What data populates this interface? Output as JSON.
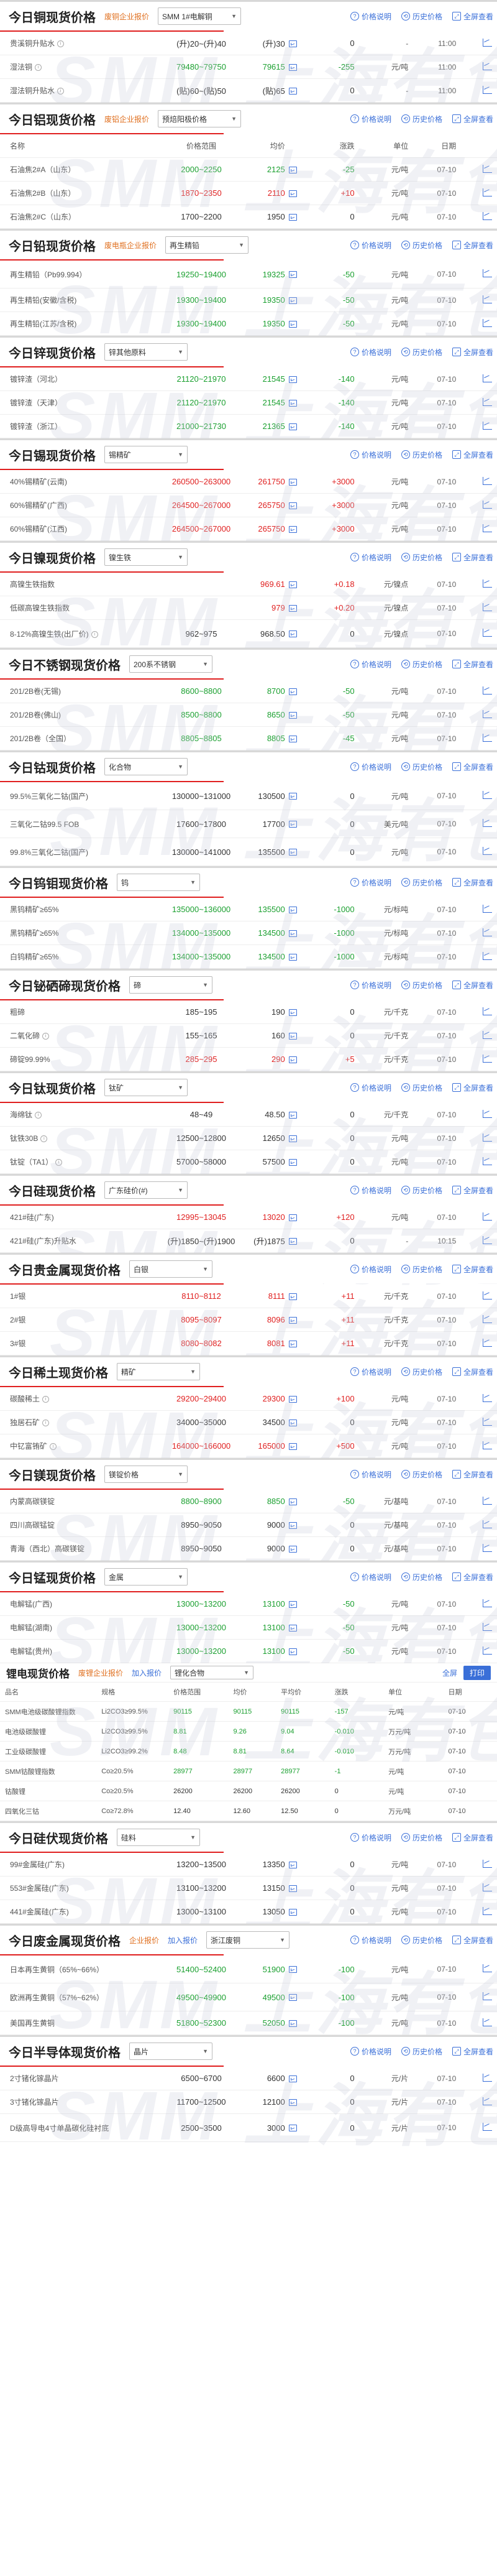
{
  "sections": [
    {
      "title": "今日铜现货价格",
      "sub": "废铜企业报价",
      "select": "SMM 1#电解铜",
      "actions": [
        "价格说明",
        "历史价格",
        "全屏查看"
      ],
      "rows": [
        {
          "name": "贵溪铜升贴水",
          "info": true,
          "range": "(升)20~(升)40",
          "avg": "(升)30",
          "chg": "0",
          "dir": "neutral",
          "unit": "-",
          "date": "11:00"
        },
        {
          "name": "湿法铜",
          "info": true,
          "range": "79480~79750",
          "avg": "79615",
          "chg": "-255",
          "dir": "down",
          "unit": "元/吨",
          "date": "11:00"
        },
        {
          "name": "湿法铜升贴水",
          "info": true,
          "range": "(贴)60~(贴)50",
          "avg": "(贴)65",
          "chg": "0",
          "dir": "neutral",
          "unit": "-",
          "date": "11:00"
        }
      ]
    },
    {
      "title": "今日铝现货价格",
      "sub": "废铝企业报价",
      "select": "预焙阳极价格",
      "actions": [
        "价格说明",
        "历史价格",
        "全屏查看"
      ],
      "header": {
        "name": "名称",
        "range": "价格范围",
        "avg": "均价",
        "chg": "涨跌",
        "unit": "单位",
        "date": "日期"
      },
      "rows": [
        {
          "name": "石油焦2#A（山东）",
          "range": "2000~2250",
          "avg": "2125",
          "chg": "-25",
          "dir": "down",
          "unit": "元/吨",
          "date": "07-10"
        },
        {
          "name": "石油焦2#B（山东）",
          "range": "1870~2350",
          "avg": "2110",
          "chg": "+10",
          "dir": "up",
          "unit": "元/吨",
          "date": "07-10"
        },
        {
          "name": "石油焦2#C（山东）",
          "range": "1700~2200",
          "avg": "1950",
          "chg": "0",
          "dir": "neutral",
          "unit": "元/吨",
          "date": "07-10"
        }
      ]
    },
    {
      "title": "今日铅现货价格",
      "sub": "废电瓶企业报价",
      "select": "再生精铅",
      "actions": [
        "价格说明",
        "历史价格",
        "全屏查看"
      ],
      "rows": [
        {
          "name": "再生精铅（Pb99.994）",
          "range": "19250~19400",
          "avg": "19325",
          "chg": "-50",
          "dir": "down",
          "unit": "元/吨",
          "date": "07-10"
        },
        {
          "name": "再生精铅(安徽/含税)",
          "range": "19300~19400",
          "avg": "19350",
          "chg": "-50",
          "dir": "down",
          "unit": "元/吨",
          "date": "07-10"
        },
        {
          "name": "再生精铅(江苏/含税)",
          "range": "19300~19400",
          "avg": "19350",
          "chg": "-50",
          "dir": "down",
          "unit": "元/吨",
          "date": "07-10"
        }
      ]
    },
    {
      "title": "今日锌现货价格",
      "select": "锌其他原料",
      "actions": [
        "价格说明",
        "历史价格",
        "全屏查看"
      ],
      "rows": [
        {
          "name": "镀锌渣（河北）",
          "range": "21120~21970",
          "avg": "21545",
          "chg": "-140",
          "dir": "down",
          "unit": "元/吨",
          "date": "07-10"
        },
        {
          "name": "镀锌渣（天津）",
          "range": "21120~21970",
          "avg": "21545",
          "chg": "-140",
          "dir": "down",
          "unit": "元/吨",
          "date": "07-10"
        },
        {
          "name": "镀锌渣（浙江）",
          "range": "21000~21730",
          "avg": "21365",
          "chg": "-140",
          "dir": "down",
          "unit": "元/吨",
          "date": "07-10"
        }
      ]
    },
    {
      "title": "今日锡现货价格",
      "select": "锡精矿",
      "actions": [
        "价格说明",
        "历史价格",
        "全屏查看"
      ],
      "rows": [
        {
          "name": "40%锡精矿(云南)",
          "range": "260500~263000",
          "avg": "261750",
          "chg": "+3000",
          "dir": "up",
          "unit": "元/吨",
          "date": "07-10"
        },
        {
          "name": "60%锡精矿(广西)",
          "range": "264500~267000",
          "avg": "265750",
          "chg": "+3000",
          "dir": "up",
          "unit": "元/吨",
          "date": "07-10"
        },
        {
          "name": "60%锡精矿(江西)",
          "range": "264500~267000",
          "avg": "265750",
          "chg": "+3000",
          "dir": "up",
          "unit": "元/吨",
          "date": "07-10"
        }
      ]
    },
    {
      "title": "今日镍现货价格",
      "select": "镍生铁",
      "actions": [
        "价格说明",
        "历史价格",
        "全屏查看"
      ],
      "rows": [
        {
          "name": "高镍生铁指数",
          "range": "",
          "avg": "969.61",
          "chg": "+0.18",
          "dir": "up",
          "unit": "元/镍点",
          "date": "07-10"
        },
        {
          "name": "低碳高镍生铁指数",
          "range": "",
          "avg": "979",
          "chg": "+0.20",
          "dir": "up",
          "unit": "元/镍点",
          "date": "07-10"
        },
        {
          "name": "8-12%高镍生铁(出厂价)",
          "info": true,
          "range": "962~975",
          "avg": "968.50",
          "chg": "0",
          "dir": "neutral",
          "unit": "元/镍点",
          "date": "07-10"
        }
      ]
    },
    {
      "title": "今日不锈钢现货价格",
      "select": "200系不锈钢",
      "actions": [
        "价格说明",
        "历史价格",
        "全屏查看"
      ],
      "rows": [
        {
          "name": "201/2B卷(无锡)",
          "range": "8600~8800",
          "avg": "8700",
          "chg": "-50",
          "dir": "down",
          "unit": "元/吨",
          "date": "07-10"
        },
        {
          "name": "201/2B卷(佛山)",
          "range": "8500~8800",
          "avg": "8650",
          "chg": "-50",
          "dir": "down",
          "unit": "元/吨",
          "date": "07-10"
        },
        {
          "name": "201/2B卷（全国）",
          "range": "8805~8805",
          "avg": "8805",
          "chg": "-45",
          "dir": "down",
          "unit": "元/吨",
          "date": "07-10"
        }
      ]
    },
    {
      "title": "今日钴现货价格",
      "select": "化合物",
      "actions": [
        "价格说明",
        "历史价格",
        "全屏查看"
      ],
      "rows": [
        {
          "name": "99.5%三氧化二钴(国产)",
          "range": "130000~131000",
          "avg": "130500",
          "chg": "0",
          "dir": "neutral",
          "unit": "元/吨",
          "date": "07-10"
        },
        {
          "name": "三氧化二钴99.5 FOB",
          "range": "17600~17800",
          "avg": "17700",
          "chg": "0",
          "dir": "neutral",
          "unit": "美元/吨",
          "date": "07-10"
        },
        {
          "name": "99.8%三氧化二钴(国产)",
          "range": "130000~141000",
          "avg": "135500",
          "chg": "0",
          "dir": "neutral",
          "unit": "元/吨",
          "date": "07-10"
        }
      ]
    },
    {
      "title": "今日钨钼现货价格",
      "select": "钨",
      "actions": [
        "价格说明",
        "历史价格",
        "全屏查看"
      ],
      "rows": [
        {
          "name": "黑钨精矿≥65%",
          "range": "135000~136000",
          "avg": "135500",
          "chg": "-1000",
          "dir": "down",
          "unit": "元/标吨",
          "date": "07-10"
        },
        {
          "name": "黑钨精矿≥65%",
          "range": "134000~135000",
          "avg": "134500",
          "chg": "-1000",
          "dir": "down",
          "unit": "元/标吨",
          "date": "07-10"
        },
        {
          "name": "白钨精矿≥65%",
          "range": "134000~135000",
          "avg": "134500",
          "chg": "-1000",
          "dir": "down",
          "unit": "元/标吨",
          "date": "07-10"
        }
      ]
    },
    {
      "title": "今日铋硒碲现货价格",
      "select": "碲",
      "actions": [
        "价格说明",
        "历史价格",
        "全屏查看"
      ],
      "rows": [
        {
          "name": "粗碲",
          "range": "185~195",
          "avg": "190",
          "chg": "0",
          "dir": "neutral",
          "unit": "元/千克",
          "date": "07-10"
        },
        {
          "name": "二氧化碲",
          "info": true,
          "range": "155~165",
          "avg": "160",
          "chg": "0",
          "dir": "neutral",
          "unit": "元/千克",
          "date": "07-10"
        },
        {
          "name": "碲锭99.99%",
          "range": "285~295",
          "avg": "290",
          "chg": "+5",
          "dir": "up",
          "unit": "元/千克",
          "date": "07-10"
        }
      ]
    },
    {
      "title": "今日钛现货价格",
      "select": "钛矿",
      "actions": [
        "价格说明",
        "历史价格",
        "全屏查看"
      ],
      "rows": [
        {
          "name": "海绵钛",
          "info": true,
          "range": "48~49",
          "avg": "48.50",
          "chg": "0",
          "dir": "neutral",
          "unit": "元/千克",
          "date": "07-10"
        },
        {
          "name": "钛铁30B",
          "info": true,
          "range": "12500~12800",
          "avg": "12650",
          "chg": "0",
          "dir": "neutral",
          "unit": "元/吨",
          "date": "07-10"
        },
        {
          "name": "钛锭（TA1）",
          "info": true,
          "range": "57000~58000",
          "avg": "57500",
          "chg": "0",
          "dir": "neutral",
          "unit": "元/吨",
          "date": "07-10"
        }
      ]
    },
    {
      "title": "今日硅现货价格",
      "select": "广东硅价(#)",
      "actions": [
        "价格说明",
        "历史价格",
        "全屏查看"
      ],
      "rows": [
        {
          "name": "421#硅(广东)",
          "range": "12995~13045",
          "avg": "13020",
          "chg": "+120",
          "dir": "up",
          "unit": "元/吨",
          "date": "07-10"
        },
        {
          "name": "421#硅(广东)升贴水",
          "range": "(升)1850~(升)1900",
          "avg": "(升)1875",
          "chg": "0",
          "dir": "neutral",
          "unit": "-",
          "date": "10:15"
        }
      ]
    },
    {
      "title": "今日贵金属现货价格",
      "select": "白银",
      "actions": [
        "价格说明",
        "历史价格",
        "全屏查看"
      ],
      "rows": [
        {
          "name": "1#银",
          "range": "8110~8112",
          "avg": "8111",
          "chg": "+11",
          "dir": "up",
          "unit": "元/千克",
          "date": "07-10"
        },
        {
          "name": "2#银",
          "range": "8095~8097",
          "avg": "8096",
          "chg": "+11",
          "dir": "up",
          "unit": "元/千克",
          "date": "07-10"
        },
        {
          "name": "3#银",
          "range": "8080~8082",
          "avg": "8081",
          "chg": "+11",
          "dir": "up",
          "unit": "元/千克",
          "date": "07-10"
        }
      ]
    },
    {
      "title": "今日稀土现货价格",
      "select": "精矿",
      "actions": [
        "价格说明",
        "历史价格",
        "全屏查看"
      ],
      "rows": [
        {
          "name": "碳酸稀土",
          "info": true,
          "range": "29200~29400",
          "avg": "29300",
          "chg": "+100",
          "dir": "up",
          "unit": "元/吨",
          "date": "07-10"
        },
        {
          "name": "独居石矿",
          "info": true,
          "range": "34000~35000",
          "avg": "34500",
          "chg": "0",
          "dir": "neutral",
          "unit": "元/吨",
          "date": "07-10"
        },
        {
          "name": "中钇富铕矿",
          "info": true,
          "range": "164000~166000",
          "avg": "165000",
          "chg": "+500",
          "dir": "up",
          "unit": "元/吨",
          "date": "07-10"
        }
      ]
    },
    {
      "title": "今日镁现货价格",
      "select": "镁锭价格",
      "actions": [
        "价格说明",
        "历史价格",
        "全屏查看"
      ],
      "rows": [
        {
          "name": "内蒙高碳镁锭",
          "range": "8800~8900",
          "avg": "8850",
          "chg": "-50",
          "dir": "down",
          "unit": "元/基吨",
          "date": "07-10"
        },
        {
          "name": "四川高碳锰锭",
          "range": "8950~9050",
          "avg": "9000",
          "chg": "0",
          "dir": "neutral",
          "unit": "元/基吨",
          "date": "07-10"
        },
        {
          "name": "青海（西北）高碳镁锭",
          "range": "8950~9050",
          "avg": "9000",
          "chg": "0",
          "dir": "neutral",
          "unit": "元/基吨",
          "date": "07-10"
        }
      ]
    },
    {
      "title": "今日锰现货价格",
      "select": "金属",
      "actions": [
        "价格说明",
        "历史价格",
        "全屏查看"
      ],
      "rows": [
        {
          "name": "电解锰(广西)",
          "range": "13000~13200",
          "avg": "13100",
          "chg": "-50",
          "dir": "down",
          "unit": "元/吨",
          "date": "07-10"
        },
        {
          "name": "电解锰(湖南)",
          "range": "13000~13200",
          "avg": "13100",
          "chg": "-50",
          "dir": "down",
          "unit": "元/吨",
          "date": "07-10"
        },
        {
          "name": "电解锰(贵州)",
          "range": "13000~13200",
          "avg": "13100",
          "chg": "-50",
          "dir": "down",
          "unit": "元/吨",
          "date": "07-10"
        }
      ]
    }
  ],
  "lithium": {
    "title": "锂电现货价格",
    "sub": "废锂企业报价",
    "sub2": "加入报价",
    "select": "锂化合物",
    "full": "全屏",
    "print": "打印",
    "header": {
      "name": "品名",
      "spec": "规格",
      "range": "价格范围",
      "avg": "均价",
      "avg2": "平均价",
      "chg": "涨跌",
      "unit": "单位",
      "date": "日期"
    },
    "rows": [
      {
        "name": "SMM电池级碳酸锂指数",
        "spec": "Li2CO3≥99.5%",
        "range": "90115",
        "avg": "90115",
        "avg2": "90115",
        "chg": "-157",
        "dir": "down",
        "unit": "元/吨",
        "date": "07-10"
      },
      {
        "name": "电池级碳酸锂",
        "spec": "Li2CO3≥99.5%",
        "range": "8.81",
        "avg": "9.26",
        "avg2": "9.04",
        "chg": "-0.010",
        "dir": "down",
        "unit": "万元/吨",
        "date": "07-10"
      },
      {
        "name": "工业级碳酸锂",
        "spec": "Li2CO3≥99.2%",
        "range": "8.48",
        "avg": "8.81",
        "avg2": "8.64",
        "chg": "-0.010",
        "dir": "down",
        "unit": "万元/吨",
        "date": "07-10"
      },
      {
        "name": "SMM钴酸锂指数",
        "spec": "Co≥20.5%",
        "range": "28977",
        "avg": "28977",
        "avg2": "28977",
        "chg": "-1",
        "dir": "down",
        "unit": "元/吨",
        "date": "07-10"
      },
      {
        "name": "钴酸锂",
        "spec": "Co≥20.5%",
        "range": "26200",
        "avg": "26200",
        "avg2": "26200",
        "chg": "0",
        "dir": "neutral",
        "unit": "元/吨",
        "date": "07-10"
      },
      {
        "name": "四氧化三钴",
        "spec": "Co≥72.8%",
        "range": "12.40",
        "avg": "12.60",
        "avg2": "12.50",
        "chg": "0",
        "dir": "neutral",
        "unit": "万元/吨",
        "date": "07-10"
      }
    ]
  },
  "sections2": [
    {
      "title": "今日硅伏现货价格",
      "select": "硅料",
      "actions": [
        "价格说明",
        "历史价格",
        "全屏查看"
      ],
      "rows": [
        {
          "name": "99#金属硅(广东)",
          "range": "13200~13500",
          "avg": "13350",
          "chg": "0",
          "dir": "neutral",
          "unit": "元/吨",
          "date": "07-10"
        },
        {
          "name": "553#金属硅(广东)",
          "range": "13100~13200",
          "avg": "13150",
          "chg": "0",
          "dir": "neutral",
          "unit": "元/吨",
          "date": "07-10"
        },
        {
          "name": "441#金属硅(广东)",
          "range": "13000~13100",
          "avg": "13050",
          "chg": "0",
          "dir": "neutral",
          "unit": "元/吨",
          "date": "07-10"
        }
      ]
    },
    {
      "title": "今日废金属现货价格",
      "sub": "企业报价",
      "sub2": "加入报价",
      "select": "浙江废铜",
      "actions": [
        "价格说明",
        "历史价格",
        "全屏查看"
      ],
      "rows": [
        {
          "name": "日本再生黄铜（65%~66%）",
          "range": "51400~52400",
          "avg": "51900",
          "chg": "-100",
          "dir": "down",
          "unit": "元/吨",
          "date": "07-10"
        },
        {
          "name": "欧洲再生黄铜（57%~62%）",
          "range": "49500~49900",
          "avg": "49500",
          "chg": "-100",
          "dir": "down",
          "unit": "元/吨",
          "date": "07-10"
        },
        {
          "name": "美国再生黄铜",
          "range": "51800~52300",
          "avg": "52050",
          "chg": "-100",
          "dir": "down",
          "unit": "元/吨",
          "date": "07-10"
        }
      ]
    },
    {
      "title": "今日半导体现货价格",
      "select": "晶片",
      "actions": [
        "价格说明",
        "历史价格",
        "全屏查看"
      ],
      "rows": [
        {
          "name": "2寸锗化镓晶片",
          "range": "6500~6700",
          "avg": "6600",
          "chg": "0",
          "dir": "neutral",
          "unit": "元/片",
          "date": "07-10"
        },
        {
          "name": "3寸锗化镓晶片",
          "range": "11700~12500",
          "avg": "12100",
          "chg": "0",
          "dir": "neutral",
          "unit": "元/片",
          "date": "07-10"
        },
        {
          "name": "D级高导电4寸单晶碳化硅衬底",
          "range": "2500~3500",
          "avg": "3000",
          "chg": "0",
          "dir": "neutral",
          "unit": "元/片",
          "date": "07-10"
        }
      ]
    }
  ],
  "watermark": "SMM 上海有色网",
  "colors": {
    "up": "#e02020",
    "down": "#1ba030",
    "accent": "#3a6fd8",
    "sub": "#e07020"
  },
  "icons": {
    "info": "info-icon",
    "box": "chart-box-icon",
    "trend": "trend-icon"
  }
}
